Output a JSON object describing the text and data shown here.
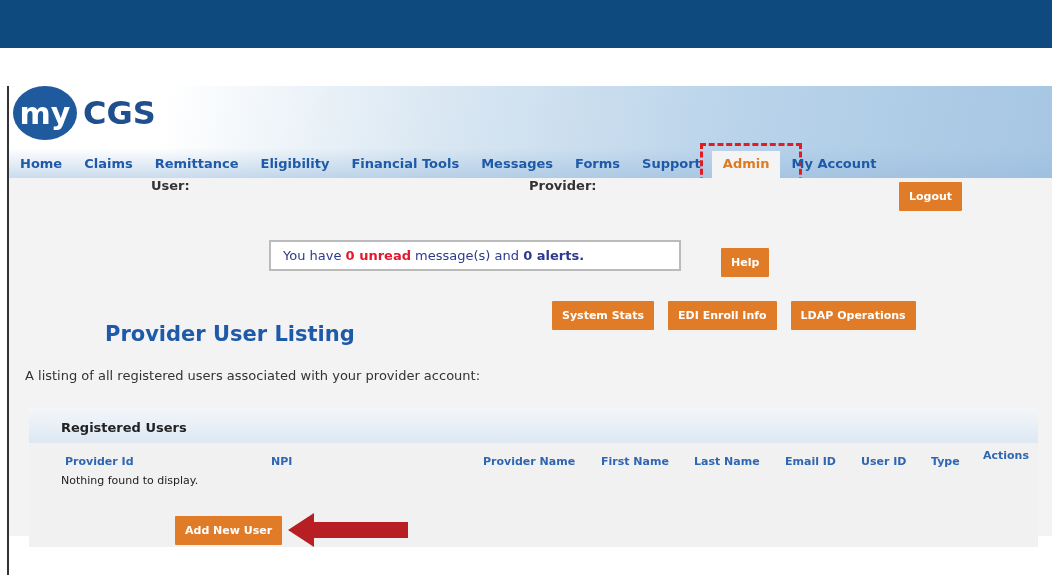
{
  "logo": {
    "badge": "my",
    "name": "CGS"
  },
  "nav": [
    {
      "label": "Home",
      "selected": false,
      "highlighted": false
    },
    {
      "label": "Claims",
      "selected": false,
      "highlighted": false
    },
    {
      "label": "Remittance",
      "selected": false,
      "highlighted": false
    },
    {
      "label": "Eligibility",
      "selected": false,
      "highlighted": false
    },
    {
      "label": "Financial Tools",
      "selected": false,
      "highlighted": false
    },
    {
      "label": "Messages",
      "selected": false,
      "highlighted": false
    },
    {
      "label": "Forms",
      "selected": false,
      "highlighted": false
    },
    {
      "label": "Support",
      "selected": false,
      "highlighted": false
    },
    {
      "label": "Admin",
      "selected": true,
      "highlighted": true
    },
    {
      "label": "My Account",
      "selected": false,
      "highlighted": false
    }
  ],
  "session": {
    "user_label": "User:",
    "provider_label": "Provider:",
    "logout": "Logout"
  },
  "message": [
    {
      "text": "You have ",
      "kind": "plain"
    },
    {
      "text": "0 unread",
      "kind": "alert"
    },
    {
      "text": " message(s) and ",
      "kind": "plain"
    },
    {
      "text": "0 alerts.",
      "kind": "strong"
    }
  ],
  "help": "Help",
  "tools": [
    "System Stats",
    "EDI Enroll Info",
    "LDAP Operations"
  ],
  "page_title": "Provider User Listing",
  "intro": "A listing of all registered users associated with your provider account:",
  "table": {
    "title": "Registered Users",
    "columns": [
      "Provider Id",
      "NPI",
      "Provider Name",
      "First Name",
      "Last Name",
      "Email ID",
      "User ID",
      "Type",
      "Actions"
    ],
    "empty": "Nothing found to display."
  },
  "add_button": {
    "label": "Add New User",
    "callout_arrow": true
  }
}
